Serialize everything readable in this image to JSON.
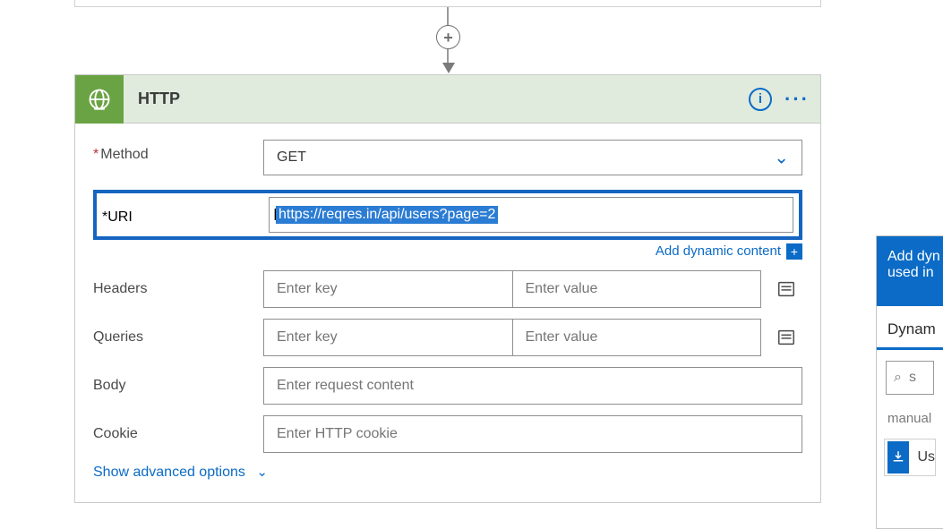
{
  "action": {
    "title": "HTTP",
    "method_label": "Method",
    "method_value": "GET",
    "uri_label": "URI",
    "uri_value": "https://reqres.in/api/users?page=2",
    "dynamic_link": "Add dynamic content",
    "headers_label": "Headers",
    "queries_label": "Queries",
    "kv_key_placeholder": "Enter key",
    "kv_value_placeholder": "Enter value",
    "body_label": "Body",
    "body_placeholder": "Enter request content",
    "cookie_label": "Cookie",
    "cookie_placeholder": "Enter HTTP cookie",
    "advanced_label": "Show advanced options"
  },
  "panel": {
    "header_line1": "Add dyn",
    "header_line2": "used in",
    "tab": "Dynam",
    "search_placeholder": "s",
    "group": "manual",
    "item_label": "Us"
  }
}
